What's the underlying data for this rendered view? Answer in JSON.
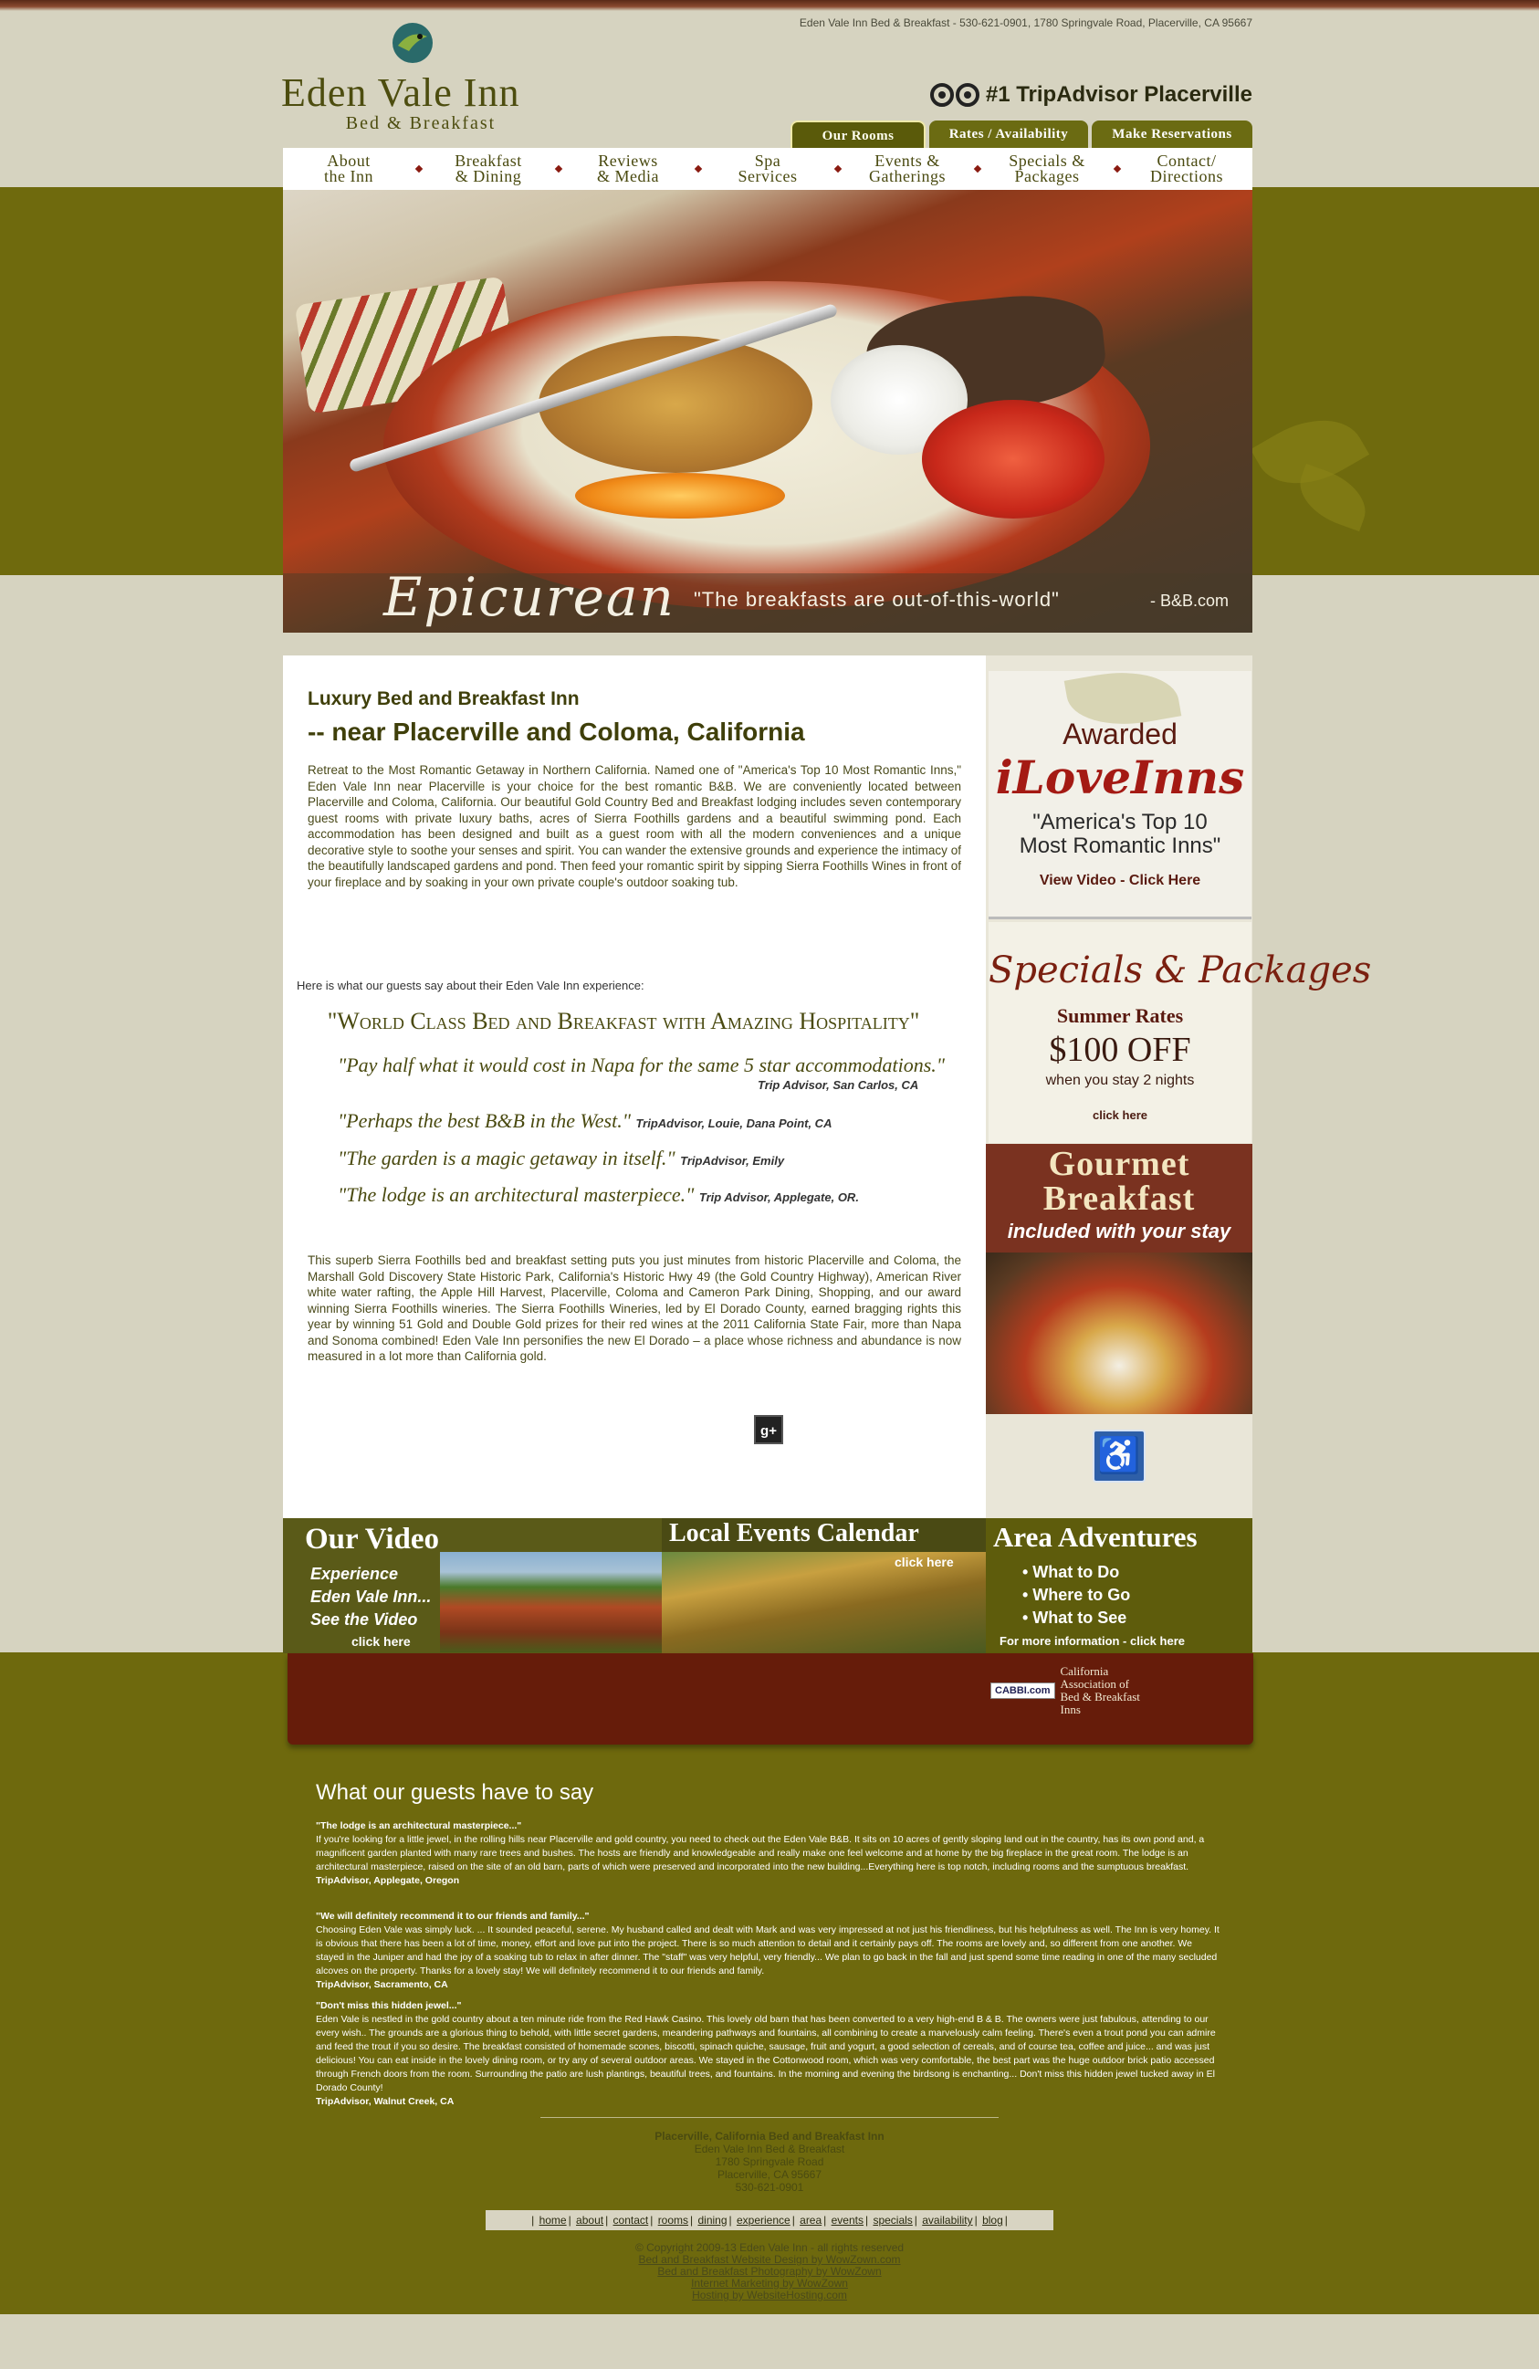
{
  "header": {
    "address": "Eden Vale Inn Bed & Breakfast - 530-621-0901, 1780 Springvale Road, Placerville, CA 95667",
    "logo_name": "Eden Vale Inn",
    "logo_sub": "Bed & Breakfast",
    "tripadvisor": "#1 TripAdvisor Placerville"
  },
  "top_tabs": [
    "Our Rooms",
    "Rates / Availability",
    "Make Reservations"
  ],
  "nav": [
    "About\nthe Inn",
    "Breakfast\n& Dining",
    "Reviews\n& Media",
    "Spa\nServices",
    "Events &\nGatherings",
    "Specials &\nPackages",
    "Contact/\nDirections"
  ],
  "hero": {
    "script": "Epicurean",
    "quote": "\"The breakfasts are out-of-this-world\"",
    "source": "- B&B.com"
  },
  "main": {
    "heading1": "Luxury Bed and Breakfast Inn",
    "heading2": "-- near Placerville and Coloma, California",
    "para1": "Retreat to the Most Romantic Getaway in Northern California. Named one of \"America's Top 10 Most Romantic Inns,\" Eden Vale Inn near Placerville is your choice for the best romantic B&B. We are conveniently located between Placerville and Coloma, California. Our beautiful Gold Country Bed and Breakfast lodging includes seven contemporary guest rooms with private luxury baths, acres of Sierra Foothills gardens and a beautiful swimming pond. Each accommodation has been designed and built as a guest room with all the modern conveniences and a unique decorative style to soothe your senses and spirit. You can wander the extensive grounds and experience the intimacy of the beautifully landscaped gardens and pond. Then feed your romantic spirit by sipping Sierra Foothills Wines in front of your fireplace and by soaking in your own private couple's outdoor soaking tub.",
    "here": "Here is what our guests say about their Eden Vale Inn experience:",
    "world_class": "\"World Class Bed and Breakfast with Amazing Hospitality\"",
    "quotes": [
      {
        "text": "\"Pay half what it would cost in Napa for the same 5 star accommodations.\"",
        "source": "Trip Advisor, San Carlos, CA"
      },
      {
        "text": "\"Perhaps the best B&B in the West.\"",
        "source": "TripAdvisor, Louie, Dana Point, CA"
      },
      {
        "text": "\"The garden is a magic getaway in itself.\"",
        "source": "TripAdvisor, Emily"
      },
      {
        "text": "\"The lodge is an architectural masterpiece.\"",
        "source": "Trip Advisor, Applegate, OR."
      }
    ],
    "para2": "This superb Sierra Foothills bed and breakfast setting puts you just minutes from historic Placerville and Coloma, the Marshall Gold Discovery State Historic Park, California's Historic Hwy 49 (the Gold Country Highway), American River white water rafting, the Apple Hill Harvest, Placerville, Coloma and Cameron Park Dining, Shopping, and our award winning Sierra Foothills wineries. The Sierra Foothills Wineries, led by El Dorado County, earned bragging rights this year by winning 51 Gold and Double Gold prizes for their red wines at the 2011 California State Fair, more than Napa and Sonoma combined! Eden Vale Inn personifies the new El Dorado – a place whose richness and abundance is now measured in a lot more than California gold.",
    "gplus": "g+"
  },
  "sidebar": {
    "awarded": "Awarded",
    "ilove": "iLoveInns",
    "top10": "\"America's Top 10\nMost Romantic Inns\"",
    "view_video": "View Video - Click Here",
    "specials_title": "Specials & Packages",
    "summer": "Summer Rates",
    "off": "$100 OFF",
    "stay": "when you stay 2 nights",
    "click": "click here",
    "gourmet": "Gourmet Breakfast",
    "included": "included with your stay",
    "access_icon": "♿"
  },
  "promos": {
    "video_title": "Our Video",
    "video_text": "Experience\nEden Vale Inn...\nSee the Video",
    "video_click": "click here",
    "events_title": "Local Events Calendar",
    "events_click": "click here",
    "area_title": "Area Adventures",
    "area_items": [
      "• What to Do",
      "• Where to Go",
      "• What to See"
    ],
    "area_more": "For more information - click here"
  },
  "cabbi": {
    "badge": "CABBI.com",
    "text": "California Association of\nBed & Breakfast Inns"
  },
  "testimonials": {
    "heading": "What our guests have to say",
    "items": [
      {
        "title": "\"The lodge is an architectural masterpiece...\"",
        "body": "If you're looking for a little jewel, in the rolling hills near Placerville and gold country, you need to check out the Eden Vale B&B. It sits on 10 acres of gently sloping land out in the country, has its own pond and, a magnificent garden planted with many rare trees and bushes. The hosts are friendly and knowledgeable and really make one feel welcome and at home by the big fireplace in the great room. The lodge is an architectural masterpiece, raised on the site of an old barn, parts of which were preserved and incorporated into the new building...Everything here is top notch, including rooms and the sumptuous breakfast.",
        "source": "TripAdvisor, Applegate, Oregon"
      },
      {
        "title": "\"We will definitely recommend it to our friends and family...\"",
        "body": "Choosing Eden Vale was simply luck. ... It sounded peaceful, serene. My husband called and dealt with Mark and was very impressed at not just his friendliness, but his helpfulness as well. The Inn is very homey. It is obvious that there has been a lot of time, money, effort and love put into the project. There is so much attention to detail and it certainly pays off. The rooms are lovely and, so different from one another. We stayed in the Juniper and had the joy of a soaking tub to relax in after dinner. The \"staff\" was very helpful, very friendly... We plan to go back in the fall and just spend some time reading in one of the many secluded alcoves on the property. Thanks for a lovely stay! We will definitely recommend it to our friends and family.",
        "source": "TripAdvisor, Sacramento, CA"
      },
      {
        "title": "\"Don't miss this hidden jewel...\"",
        "body": "Eden Vale is nestled in the gold country about a ten minute ride from the Red Hawk Casino. This lovely old barn that has been converted to a very high-end B & B. The owners were just fabulous, attending to our every wish.. The grounds are a glorious thing to behold, with little secret gardens, meandering pathways and fountains, all combining to create a marvelously calm feeling. There's even a trout pond you can admire and feed the trout if you so desire. The breakfast consisted of homemade scones, biscotti, spinach quiche, sausage, fruit and yogurt, a good selection of cereals, and of course tea, coffee and juice... and was just delicious! You can eat inside in the lovely dining room, or try any of several outdoor areas. We stayed in the Cottonwood room, which was very comfortable, the best part was the huge outdoor brick patio accessed through French doors from the room. Surrounding the patio are lush plantings, beautiful trees, and fountains. In the morning and evening the birdsong is enchanting... Don't miss this hidden jewel tucked away in El Dorado County!",
        "source": "TripAdvisor, Walnut Creek, CA"
      }
    ]
  },
  "footer": {
    "biz_title": "Placerville, California Bed and Breakfast Inn",
    "biz_name": "Eden Vale Inn Bed & Breakfast",
    "street": "1780 Springvale Road",
    "city": "Placerville, CA 95667",
    "phone": "530-621-0901",
    "links": [
      "home",
      "about",
      "contact",
      "rooms",
      "dining",
      "experience",
      "area",
      "events",
      "specials",
      "availability",
      "blog"
    ],
    "copyright": "© Copyright 2009-13 Eden Vale Inn - all rights reserved",
    "credits": [
      "Bed and Breakfast Website Design by WowZown.com",
      "Bed and Breakfast Photography by WowZown",
      "Internet Marketing by WowZown",
      "Hosting by WebsiteHosting.com"
    ]
  }
}
